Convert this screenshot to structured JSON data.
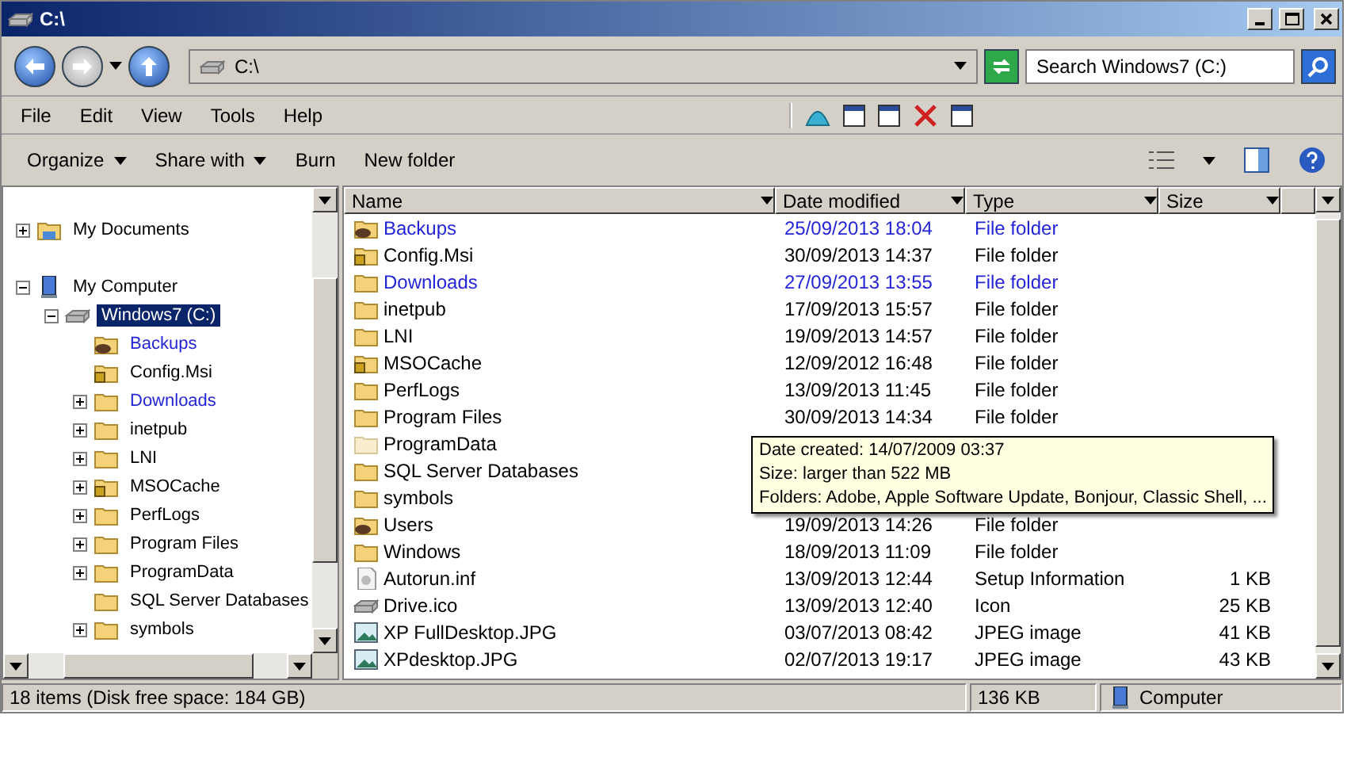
{
  "window": {
    "title": "C:\\"
  },
  "address": {
    "path": "C:\\"
  },
  "search": {
    "placeholder": "Search Windows7 (C:)"
  },
  "menu": [
    "File",
    "Edit",
    "View",
    "Tools",
    "Help"
  ],
  "commands": [
    {
      "label": "Organize",
      "dropdown": true
    },
    {
      "label": "Share with",
      "dropdown": true
    },
    {
      "label": "Burn",
      "dropdown": false
    },
    {
      "label": "New folder",
      "dropdown": false
    }
  ],
  "tree": [
    {
      "label": "My Documents",
      "kind": "documents",
      "expandable": true,
      "expanded": false,
      "selected": false,
      "compressed": false
    },
    {
      "label": "My Computer",
      "kind": "computer",
      "expandable": true,
      "expanded": true,
      "selected": false,
      "compressed": false,
      "children": [
        {
          "label": "Windows7 (C:)",
          "kind": "drive",
          "expandable": true,
          "expanded": true,
          "selected": true,
          "compressed": false,
          "children": [
            {
              "label": "Backups",
              "kind": "shared",
              "selected": false,
              "compressed": true
            },
            {
              "label": "Config.Msi",
              "kind": "locked",
              "selected": false,
              "compressed": false
            },
            {
              "label": "Downloads",
              "kind": "folder",
              "expandable": true,
              "expanded": false,
              "selected": false,
              "compressed": true
            },
            {
              "label": "inetpub",
              "kind": "folder",
              "expandable": true,
              "expanded": false,
              "selected": false,
              "compressed": false
            },
            {
              "label": "LNI",
              "kind": "folder",
              "expandable": true,
              "expanded": false,
              "selected": false,
              "compressed": false
            },
            {
              "label": "MSOCache",
              "kind": "locked",
              "expandable": true,
              "expanded": false,
              "selected": false,
              "compressed": false
            },
            {
              "label": "PerfLogs",
              "kind": "folder",
              "expandable": true,
              "expanded": false,
              "selected": false,
              "compressed": false
            },
            {
              "label": "Program Files",
              "kind": "folder",
              "expandable": true,
              "expanded": false,
              "selected": false,
              "compressed": false
            },
            {
              "label": "ProgramData",
              "kind": "folder",
              "expandable": true,
              "expanded": false,
              "selected": false,
              "compressed": false
            },
            {
              "label": "SQL Server Databases",
              "kind": "folder",
              "selected": false,
              "compressed": false
            },
            {
              "label": "symbols",
              "kind": "folder",
              "expandable": true,
              "expanded": false,
              "selected": false,
              "compressed": false
            }
          ]
        }
      ]
    }
  ],
  "columns": [
    "Name",
    "Date modified",
    "Type",
    "Size"
  ],
  "files": [
    {
      "name": "Backups",
      "kind": "shared",
      "date": "25/09/2013 18:04",
      "type": "File folder",
      "compressed": true
    },
    {
      "name": "Config.Msi",
      "kind": "locked",
      "date": "30/09/2013 14:37",
      "type": "File folder",
      "compressed": false
    },
    {
      "name": "Downloads",
      "kind": "folder",
      "date": "27/09/2013 13:55",
      "type": "File folder",
      "compressed": true
    },
    {
      "name": "inetpub",
      "kind": "folder",
      "date": "17/09/2013 15:57",
      "type": "File folder",
      "compressed": false
    },
    {
      "name": "LNI",
      "kind": "folder",
      "date": "19/09/2013 14:57",
      "type": "File folder",
      "compressed": false
    },
    {
      "name": "MSOCache",
      "kind": "locked",
      "date": "12/09/2012 16:48",
      "type": "File folder",
      "compressed": false
    },
    {
      "name": "PerfLogs",
      "kind": "folder",
      "date": "13/09/2013 11:45",
      "type": "File folder",
      "compressed": false
    },
    {
      "name": "Program Files",
      "kind": "folder",
      "date": "30/09/2013 14:34",
      "type": "File folder",
      "compressed": false
    },
    {
      "name": "ProgramData",
      "kind": "hidden",
      "compressed": false
    },
    {
      "name": "SQL Server Databases",
      "kind": "folder",
      "compressed": false
    },
    {
      "name": "symbols",
      "kind": "folder",
      "compressed": false
    },
    {
      "name": "Users",
      "kind": "shared",
      "date": "19/09/2013 14:26",
      "type": "File folder",
      "compressed": false
    },
    {
      "name": "Windows",
      "kind": "folder",
      "date": "18/09/2013 11:09",
      "type": "File folder",
      "compressed": false
    },
    {
      "name": "Autorun.inf",
      "kind": "settings",
      "date": "13/09/2013 12:44",
      "type": "Setup Information",
      "size": "1 KB",
      "compressed": false
    },
    {
      "name": "Drive.ico",
      "kind": "drive",
      "date": "13/09/2013 12:40",
      "type": "Icon",
      "size": "25 KB",
      "compressed": false
    },
    {
      "name": "XP FullDesktop.JPG",
      "kind": "image",
      "date": "03/07/2013 08:42",
      "type": "JPEG image",
      "size": "41 KB",
      "compressed": false
    },
    {
      "name": "XPdesktop.JPG",
      "kind": "image",
      "date": "02/07/2013 19:17",
      "type": "JPEG image",
      "size": "43 KB",
      "compressed": false
    }
  ],
  "tooltip": [
    "Date created: 14/07/2009 03:37",
    "Size: larger than 522 MB",
    "Folders: Adobe, Apple Software Update, Bonjour, Classic Shell, ..."
  ],
  "status": {
    "items": "18 items (Disk free space: 184 GB)",
    "size": "136 KB",
    "zone": "Computer"
  }
}
